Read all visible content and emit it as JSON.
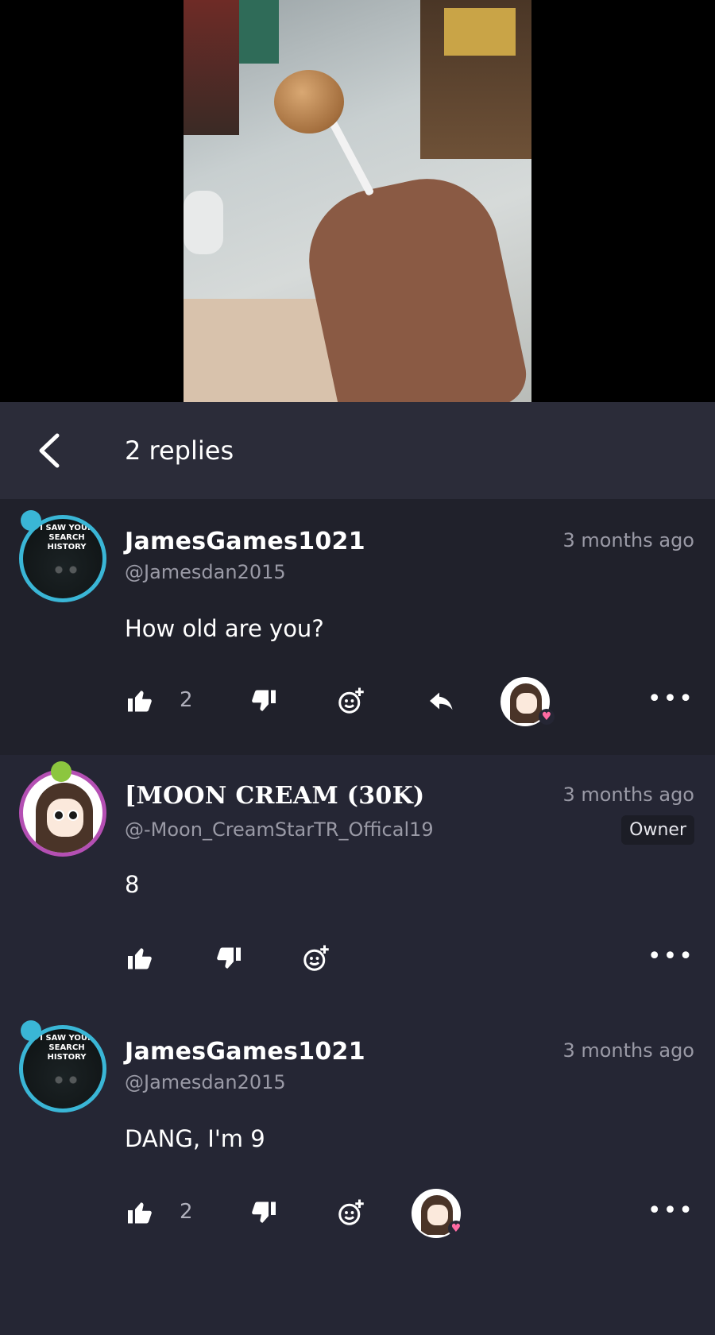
{
  "header": {
    "title": "2 replies"
  },
  "comments": [
    {
      "name": "JamesGames1021",
      "handle": "@Jamesdan2015",
      "time": "3 months ago",
      "body": "How old are you?",
      "likes": "2",
      "avatar_text": "I SAW YOUR SEARCH HISTORY"
    },
    {
      "name": "[MOON CREAM (30K)",
      "handle": "@-Moon_CreamStarTR_Offical19",
      "time": "3 months ago",
      "badge": "Owner",
      "body": "8",
      "likes": ""
    },
    {
      "name": "JamesGames1021",
      "handle": "@Jamesdan2015",
      "time": "3 months ago",
      "body": "DANG, I'm 9",
      "likes": "2",
      "avatar_text": "I SAW YOUR SEARCH HISTORY"
    }
  ],
  "icons": {
    "back": "chevron-left-icon",
    "like": "thumbs-up-icon",
    "dislike": "thumbs-down-icon",
    "emoji": "add-reaction-icon",
    "reply": "reply-icon",
    "more": "more-horizontal-icon"
  },
  "colors": {
    "background": "#252634",
    "header": "#2b2c39",
    "highlight": "#20212b",
    "muted": "#9a9aa6",
    "ring_blue": "#3ab6d6",
    "ring_purple": "#b44fb3"
  }
}
